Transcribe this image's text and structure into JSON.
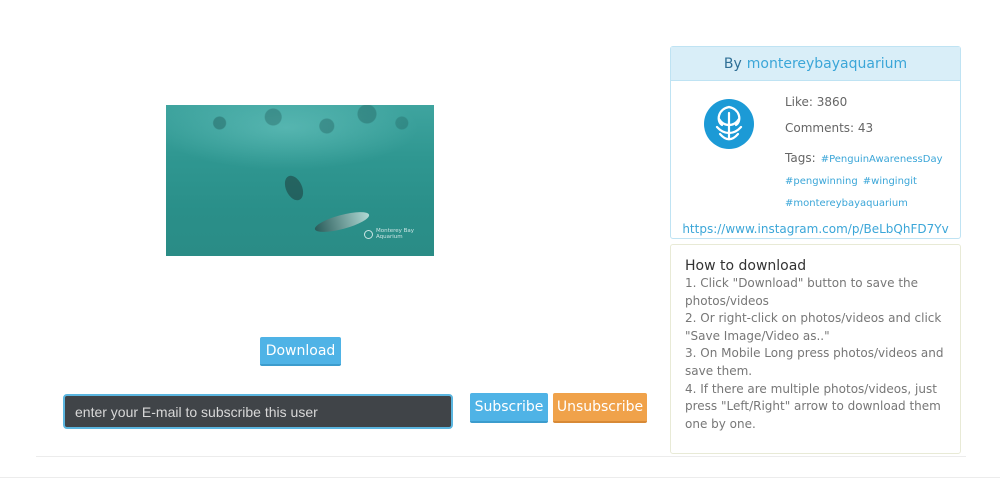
{
  "download": {
    "label": "Download"
  },
  "subscribe": {
    "placeholder": "enter your E-mail to subscribe this user",
    "subscribe_label": "Subscribe",
    "unsubscribe_label": "Unsubscribe"
  },
  "media": {
    "watermark_line1": "Monterey Bay",
    "watermark_line2": "Aquarium"
  },
  "profile": {
    "by_label": "By",
    "username": "montereybayaquarium",
    "likes": "Like: 3860",
    "comments": "Comments: 43",
    "tags_label": "Tags:",
    "tags": [
      "#PenguinAwarenessDay",
      "#pengwinning",
      "#wingingit",
      "#montereybayaquarium"
    ],
    "link": "https://www.instagram.com/p/BeLbQhFD7Yv"
  },
  "howto": {
    "title": "How to download",
    "steps": [
      "1. Click \"Download\" button to save the photos/videos",
      "2. Or right-click on photos/videos and click \"Save Image/Video as..\"",
      "3. On Mobile Long press photos/videos and save them.",
      "4. If there are multiple photos/videos, just press \"Left/Right\" arrow to download them one by one."
    ]
  },
  "colors": {
    "accent_blue": "#4fb3e6",
    "accent_orange": "#f0a24a",
    "avatar_blue": "#1c9ad6"
  }
}
